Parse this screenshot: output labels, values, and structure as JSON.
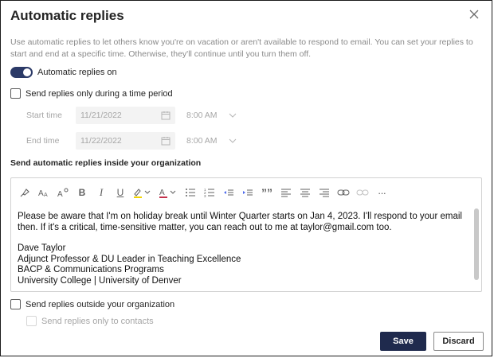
{
  "dialog": {
    "title": "Automatic replies",
    "intro": "Use automatic replies to let others know you're on vacation or aren't available to respond to email. You can set your replies to start and end at a specific time. Otherwise, they'll continue until you turn them off."
  },
  "toggle": {
    "label": "Automatic replies on",
    "on": true
  },
  "time_period": {
    "checkbox_label": "Send replies only during a time period",
    "start_label": "Start time",
    "start_date": "11/21/2022",
    "start_time": "8:00 AM",
    "end_label": "End time",
    "end_date": "11/22/2022",
    "end_time": "8:00 AM"
  },
  "inside": {
    "label": "Send automatic replies inside your organization",
    "message_lines": [
      "Please be aware that I'm on holiday break until Winter Quarter starts on Jan 4, 2023. I'll respond to your email",
      "then. If it's a critical, time-sensitive matter, you can reach out to me at taylor@gmail.com too.",
      "",
      "Dave Taylor",
      "Adjunct Professor & DU Leader in Teaching Excellence",
      "BACP & Communications Programs",
      "University College | University of Denver"
    ]
  },
  "outside": {
    "checkbox_label": "Send replies outside your organization",
    "contacts_label": "Send replies only to contacts"
  },
  "toolbar_icons": [
    "format-painter-icon",
    "font-size-icon",
    "superscript-icon",
    "bold-icon",
    "italic-icon",
    "underline-icon",
    "highlight-icon",
    "font-color-icon",
    "bullets-icon",
    "numbering-icon",
    "decrease-indent-icon",
    "increase-indent-icon",
    "quote-icon",
    "align-left-icon",
    "align-center-icon",
    "align-right-icon",
    "link-icon",
    "unlink-icon",
    "more-icon"
  ],
  "toolbar_glyphs": {
    "bold": "B",
    "italic": "I",
    "underline": "U",
    "quote": "””",
    "more": "···"
  },
  "buttons": {
    "save": "Save",
    "discard": "Discard"
  },
  "colors": {
    "accent": "#2b3a67",
    "primary_button": "#1f2a4d"
  }
}
